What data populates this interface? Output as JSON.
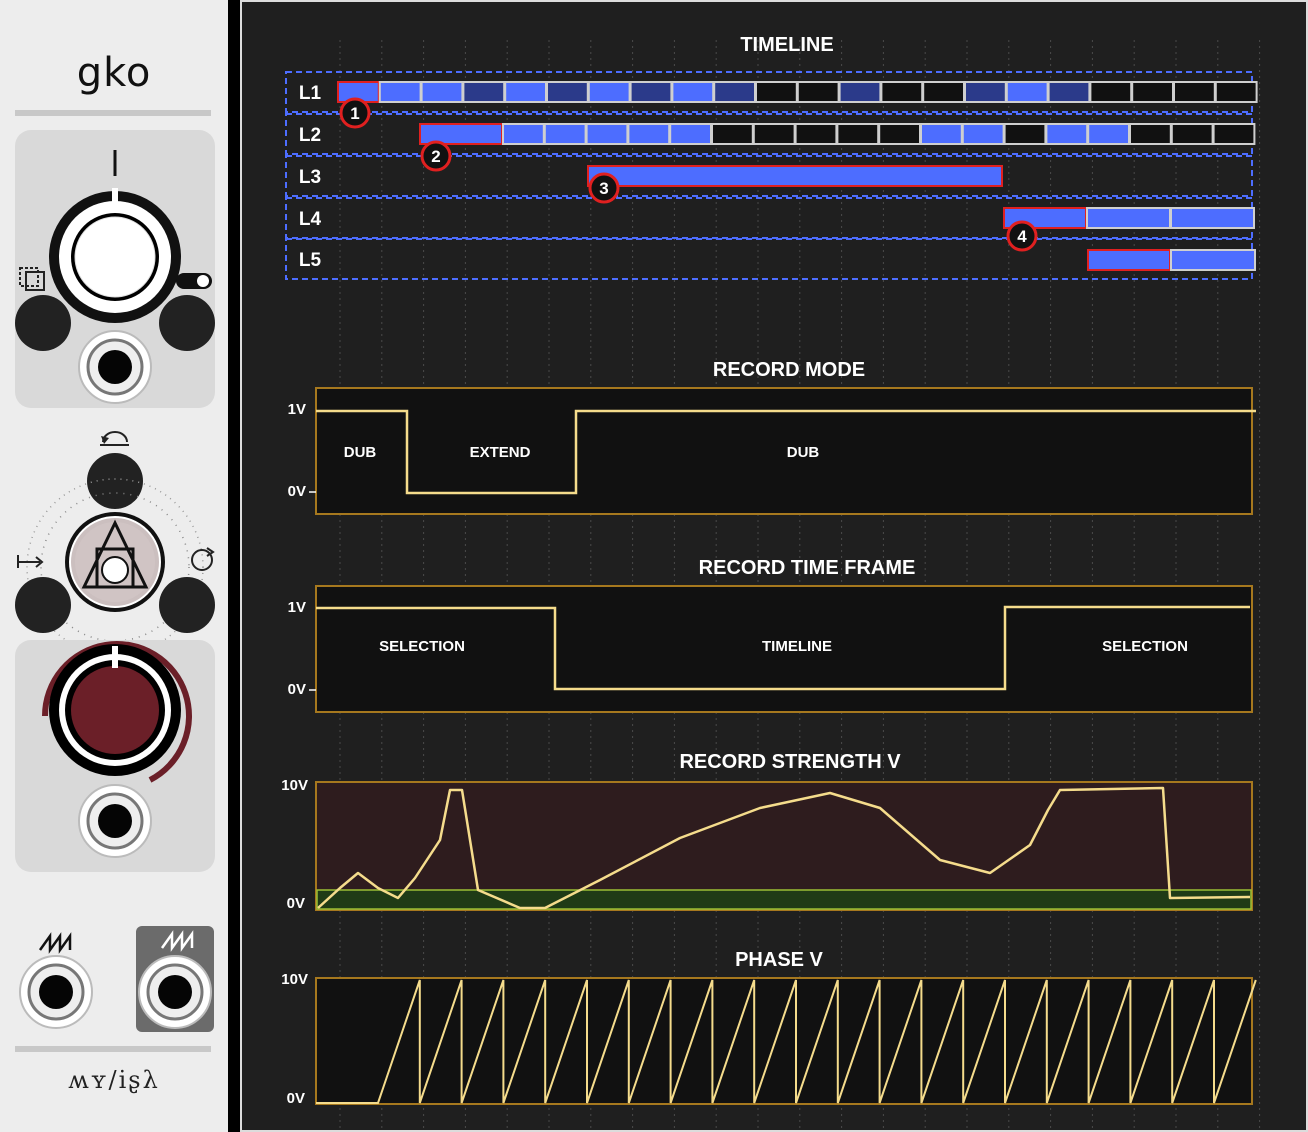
{
  "module": {
    "title": "gko",
    "brand": "ʍʏ/iʂλ",
    "icons": [
      "record-mode-icon",
      "toggle-switch-icon",
      "undo-icon",
      "skip-forward-icon",
      "loop-icon",
      "alchemy-triangle-icon",
      "sawtooth-phase-icon",
      "sawtooth-phase-out-icon"
    ]
  },
  "scope": {
    "timeline": {
      "title": "TIMELINE",
      "layers": [
        "L1",
        "L2",
        "L3",
        "L4",
        "L5"
      ],
      "markers": [
        "1",
        "2",
        "3",
        "4"
      ]
    },
    "record_mode": {
      "title": "RECORD MODE",
      "y_labels": [
        "1V",
        "0V"
      ],
      "regions": [
        "DUB",
        "EXTEND",
        "DUB"
      ]
    },
    "record_time_frame": {
      "title": "RECORD TIME FRAME",
      "y_labels": [
        "1V",
        "0V"
      ],
      "regions": [
        "SELECTION",
        "TIMELINE",
        "SELECTION"
      ]
    },
    "record_strength": {
      "title": "RECORD STRENGTH V",
      "y_labels": [
        "10V",
        "0V"
      ]
    },
    "phase": {
      "title": "PHASE V",
      "y_labels": [
        "10V",
        "0V"
      ]
    }
  },
  "colors": {
    "accent_blue": "#4d6dff",
    "outline_red": "#e02020",
    "trace_yellow": "#f5dc8c",
    "frame_gold": "#a6781e",
    "knob_red": "#6b1f28"
  }
}
